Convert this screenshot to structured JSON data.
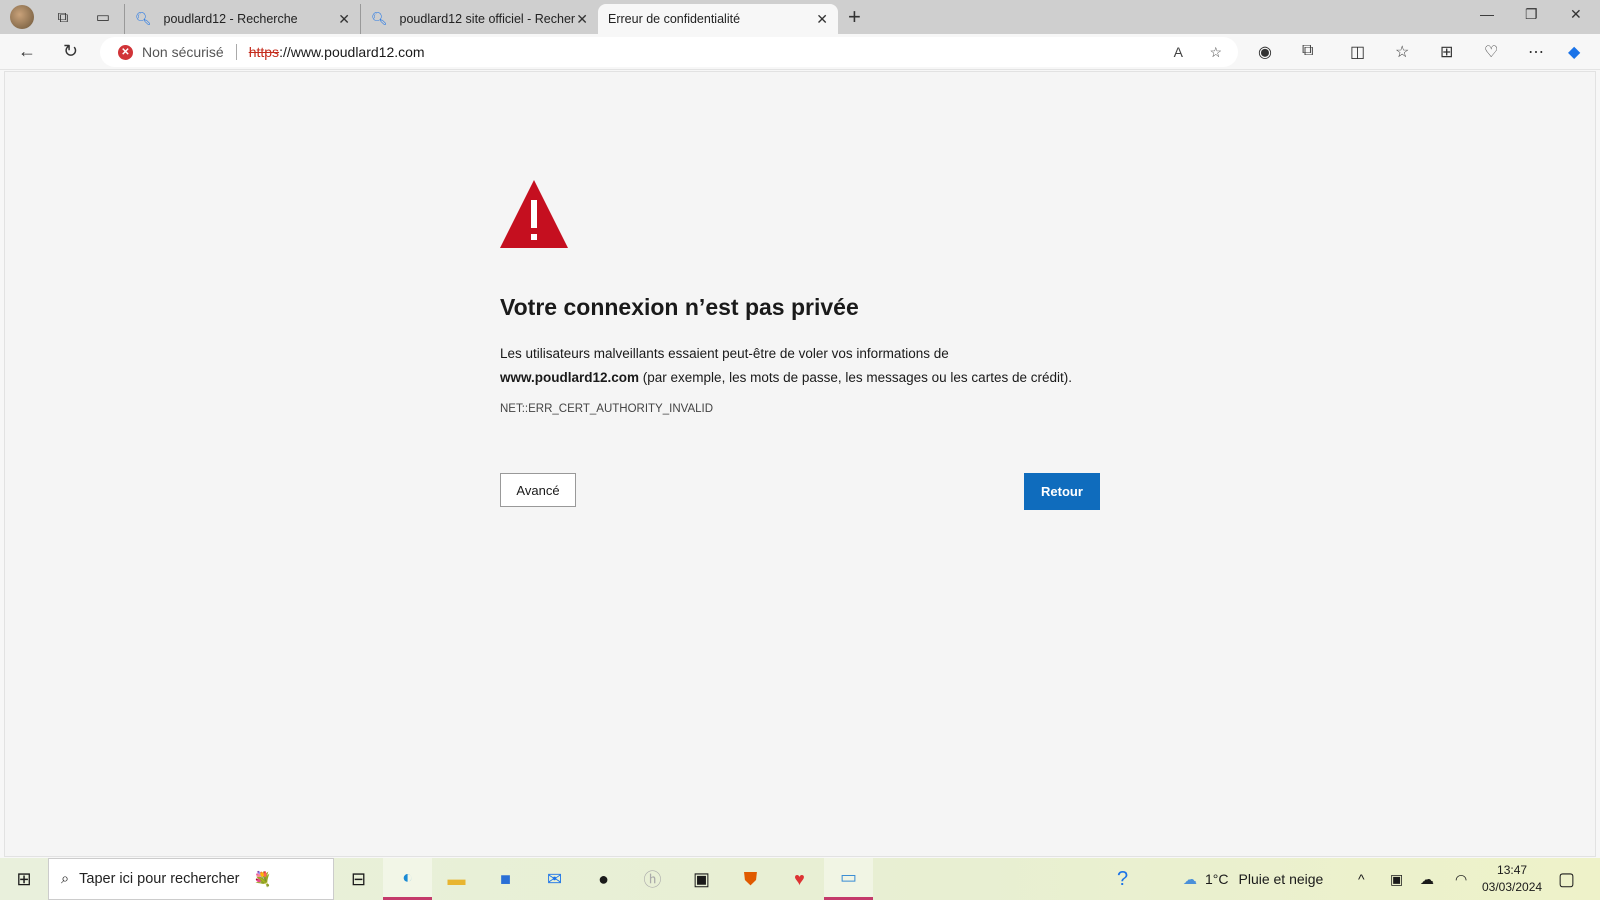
{
  "tabs": [
    {
      "label": "poudlard12 - Recherche"
    },
    {
      "label": "poudlard12 site officiel - Recherc"
    },
    {
      "label": "Erreur de confidentialité",
      "active": true
    }
  ],
  "address": {
    "security": "Non sécurisé",
    "scheme": "https",
    "rest": "://www.poudlard12.com"
  },
  "page": {
    "title": "Votre connexion n’est pas privée",
    "desc1": "Les utilisateurs malveillants essaient peut-être de voler vos informations de ",
    "domain": "www.poudlard12.com",
    "desc2": " (par exemple, les mots de passe, les messages ou les cartes de crédit).",
    "error_code": "NET::ERR_CERT_AUTHORITY_INVALID",
    "advanced": "Avancé",
    "back": "Retour"
  },
  "taskbar": {
    "search_placeholder": "Taper ici pour rechercher",
    "temp": "1°C",
    "weather": "Pluie et neige",
    "time": "13:47",
    "date": "03/03/2024"
  },
  "colors": {
    "accent": "#0f6cbd",
    "danger": "#c50f1f"
  }
}
